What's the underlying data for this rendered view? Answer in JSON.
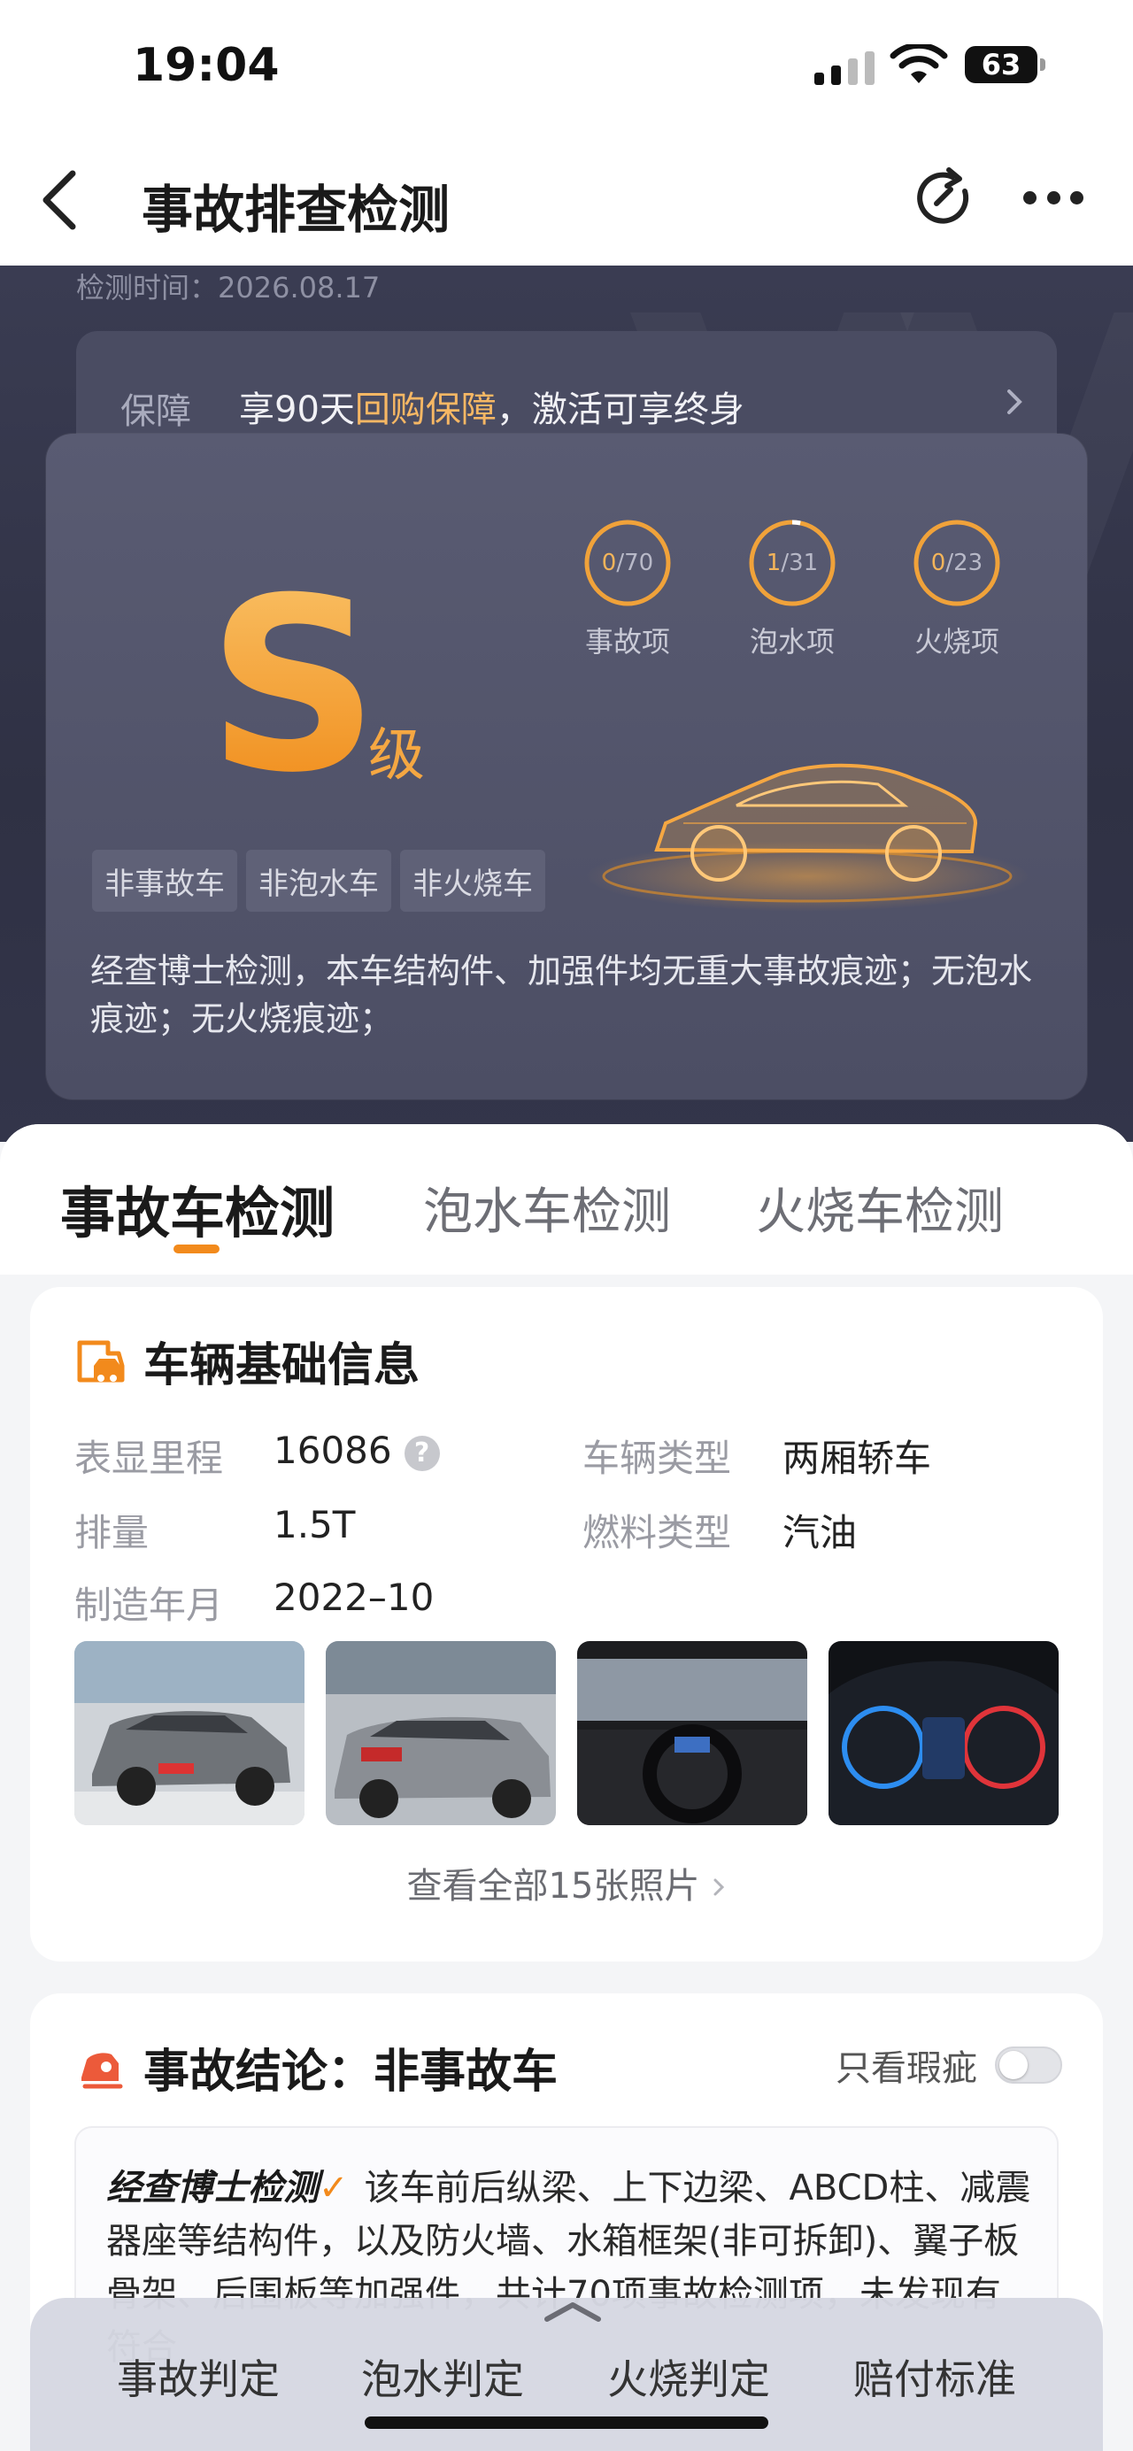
{
  "status_bar": {
    "time": "19:04",
    "battery": "63"
  },
  "nav": {
    "title": "事故排查检测"
  },
  "hero": {
    "inspection_time": "检测时间：2026.08.17",
    "guarantee_label": "保障",
    "guarantee_pre": "享90天",
    "guarantee_highlight": "回购保障",
    "guarantee_post": "，激活可享终身",
    "grade": "S",
    "grade_suffix": "级",
    "stats": [
      {
        "value": "0",
        "total": "/70",
        "label": "事故项",
        "fraction": 0.0
      },
      {
        "value": "1",
        "total": "/31",
        "label": "泡水项",
        "fraction": 0.032
      },
      {
        "value": "0",
        "total": "/23",
        "label": "火烧项",
        "fraction": 0.0
      }
    ],
    "tags": [
      "非事故车",
      "非泡水车",
      "非火烧车"
    ],
    "summary": "经查博士检测，本车结构件、加强件均无重大事故痕迹；无泡水痕迹；无火烧痕迹；"
  },
  "tabs": [
    "事故车检测",
    "泡水车检测",
    "火烧车检测"
  ],
  "basic_info": {
    "title": "车辆基础信息",
    "mileage_label": "表显里程",
    "mileage": "16086",
    "type_label": "车辆类型",
    "type": "两厢轿车",
    "displacement_label": "排量",
    "displacement": "1.5T",
    "fuel_label": "燃料类型",
    "fuel": "汽油",
    "date_label": "制造年月",
    "date": "2022–10",
    "view_all": "查看全部15张照片"
  },
  "conclusion": {
    "title": "事故结论：非事故车",
    "toggle_label": "只看瑕疵",
    "brand": "经查博士检测",
    "text": "该车前后纵梁、上下边梁、ABCD柱、减震器座等结构件，以及防火墙、水箱框架(非可拆卸)、翼子板骨架、后围板等加强件，共计70项事故检测项，未发现有符合"
  },
  "bottom_bar": [
    "事故判定",
    "泡水判定",
    "火烧判定",
    "赔付标准"
  ],
  "colors": {
    "accent": "#f28a1c",
    "grade": "#f5a742",
    "hero_bg": "#33354a"
  }
}
